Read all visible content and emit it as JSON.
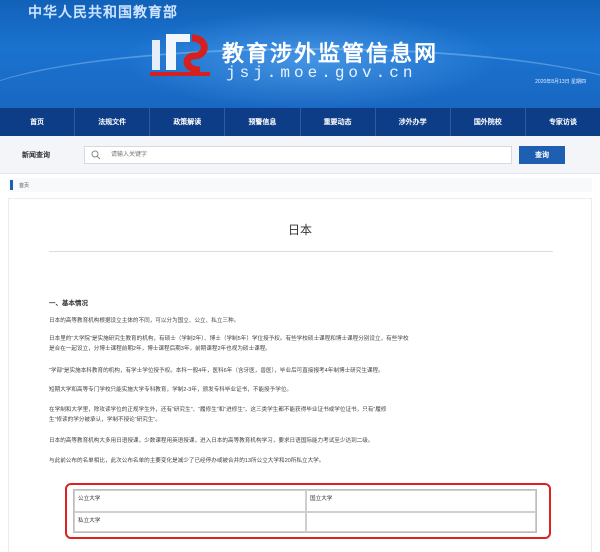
{
  "header": {
    "ministry_name": "中华人民共和国教育部",
    "site_title": "教育涉外监管信息网",
    "site_domain": "jsj.moe.gov.cn",
    "date": "2020年8月13日 星期四"
  },
  "nav": {
    "items": [
      "首页",
      "法规文件",
      "政策解读",
      "预警信息",
      "重要动态",
      "涉外办学",
      "国外院校",
      "专家访谈"
    ]
  },
  "search": {
    "label": "新闻查询",
    "placeholder": "请输入关键字",
    "button": "查询"
  },
  "breadcrumb": {
    "home": "首页"
  },
  "article": {
    "title": "日本",
    "section_heading": "一、基本情况",
    "paragraphs": [
      "日本的高等教育机构根据设立主体的不同，可以分为国立、公立、私立三种。",
      "日本里的“大学院”是实施研究生教育的机构，有硕士（学制2年）、博士（学制5年）学位授予权。有些学校硕士课程和博士课程分别设立，有些学校",
      "是合在一起设立，分博士课程前期2年，博士课程后期3年，前期课程2年也视为硕士课程。",
      "“学部”是实施本科教育的机构，有学士学位授予权。本科一般4年，医科6年（含牙医，兽医），毕业后可直接报考4年制博士研究生课程。",
      "短期大学和高等专门学校只能实施大学专科教育，学制2-3年，颁发专科毕业证书，不能授予学位。",
      "在学制和大学里，除攻读学位的正规学生外，还有“研究生”、“履修生”和“进修生”，这三类学生都不能获得毕业证书或学位证书，只有“履修",
      "生”修读的学分被承认，学制不授论“研究生”。",
      "日本的高等教育机构大多用日语授课，少数课程用英语授课，进入日本的高等教育机构学习，要求日语国际能力考试至少达到二级。",
      "与此前公布的名单相比，此次公布名单的主要变化是减少了已经停办或被合并的13所公立大学和20所私立大学。"
    ]
  },
  "university_table": {
    "rows": [
      [
        "公立大学",
        "国立大学"
      ],
      [
        "私立大学",
        ""
      ]
    ]
  },
  "colors": {
    "banner": "#1a73cf",
    "nav": "#0d3d86",
    "accent": "#1f5fb2",
    "highlight": "#e02020"
  }
}
